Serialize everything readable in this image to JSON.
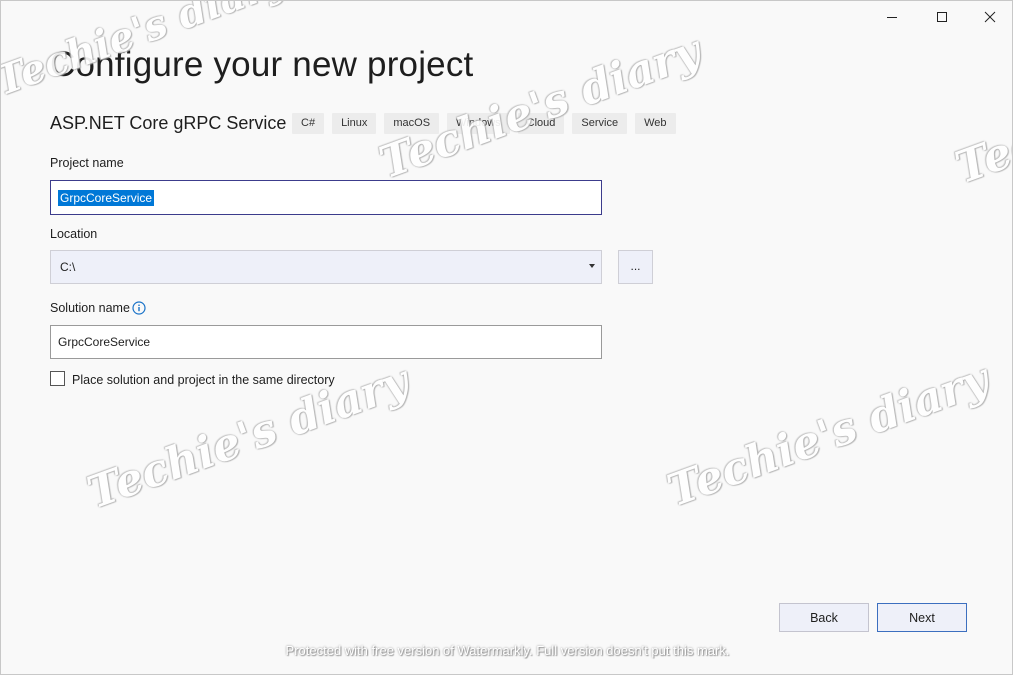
{
  "window": {
    "minimize_icon": "minimize-icon",
    "maximize_icon": "maximize-icon",
    "close_icon": "close-icon"
  },
  "page": {
    "title": "Configure your new project",
    "template_name": "ASP.NET Core gRPC Service",
    "tags": [
      "C#",
      "Linux",
      "macOS",
      "Windows",
      "Cloud",
      "Service",
      "Web"
    ]
  },
  "form": {
    "project_name_label": "Project name",
    "project_name_value": "GrpcCoreService",
    "location_label": "Location",
    "location_value": "C:\\",
    "browse_label": "...",
    "solution_name_label": "Solution name",
    "solution_name_value": "GrpcCoreService",
    "same_directory_label": "Place solution and project in the same directory",
    "same_directory_checked": false
  },
  "buttons": {
    "back": "Back",
    "next": "Next"
  },
  "watermarks": {
    "brand": "Techie's diary",
    "notice": "Protected with free version of Watermarkly. Full version doesn't put this mark."
  },
  "colors": {
    "accent": "#0078d7",
    "background": "#f9f9f9"
  }
}
